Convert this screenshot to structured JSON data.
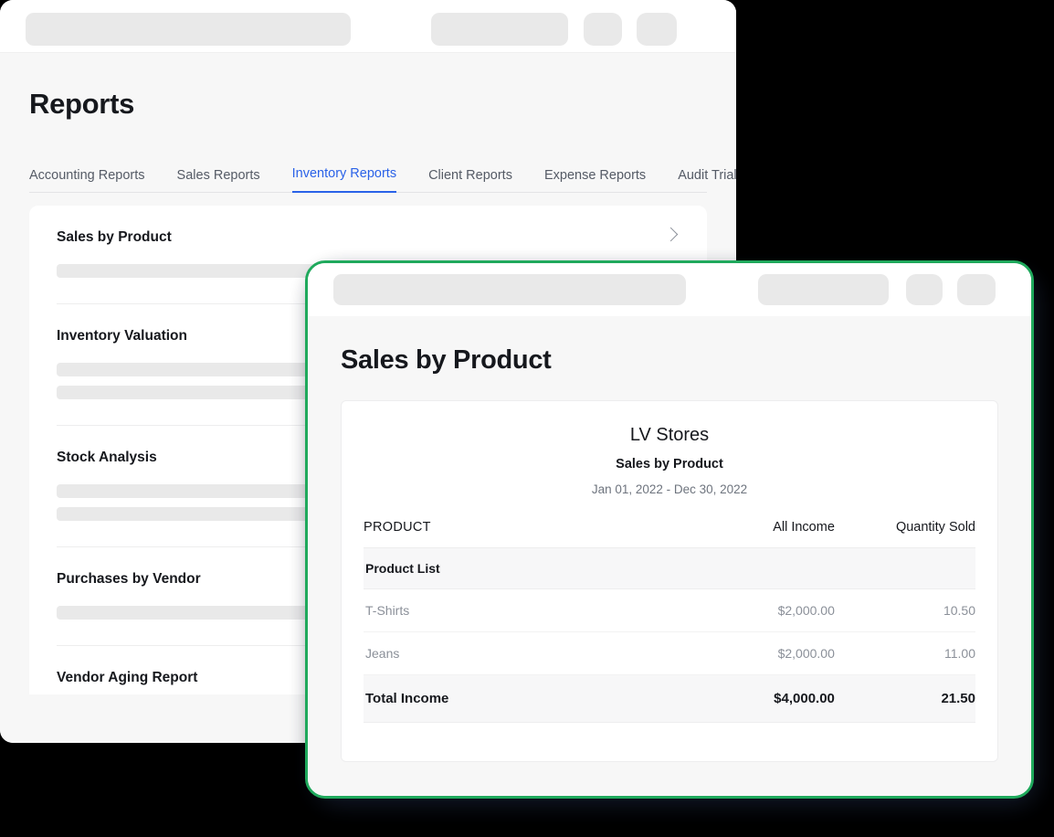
{
  "background_window": {
    "titlebar": {
      "skeleton_items": [
        "search-bar-placeholder",
        "button-placeholder",
        "icon-placeholder-1",
        "icon-placeholder-2"
      ]
    },
    "page_title": "Reports",
    "tabs": [
      {
        "label": "Accounting Reports",
        "active": false
      },
      {
        "label": "Sales Reports",
        "active": false
      },
      {
        "label": "Inventory Reports",
        "active": true
      },
      {
        "label": "Client Reports",
        "active": false
      },
      {
        "label": "Expense Reports",
        "active": false
      },
      {
        "label": "Audit Trial",
        "active": false
      }
    ],
    "active_tab_color": "#2a62e8",
    "report_list": [
      {
        "name": "Sales by Product"
      },
      {
        "name": "Inventory Valuation"
      },
      {
        "name": "Stock Analysis"
      },
      {
        "name": "Purchases by Vendor"
      },
      {
        "name": "Vendor Aging Report"
      }
    ]
  },
  "modal": {
    "accent_border_color": "#1fa95c",
    "titlebar": {
      "skeleton_items": [
        "search-bar-placeholder",
        "button-placeholder",
        "icon-placeholder-1",
        "icon-placeholder-2"
      ]
    },
    "title": "Sales by Product",
    "report": {
      "organization": "LV Stores",
      "subtitle": "Sales by Product",
      "date_range": "Jan 01, 2022 - Dec 30, 2022",
      "columns": [
        "PRODUCT",
        "All Income",
        "Quantity Sold"
      ],
      "group_label": "Product List",
      "rows": [
        {
          "product": "T-Shirts",
          "all_income": "$2,000.00",
          "quantity_sold": "10.50"
        },
        {
          "product": "Jeans",
          "all_income": "$2,000.00",
          "quantity_sold": "11.00"
        }
      ],
      "total": {
        "label": "Total Income",
        "all_income": "$4,000.00",
        "quantity_sold": "21.50"
      }
    }
  }
}
